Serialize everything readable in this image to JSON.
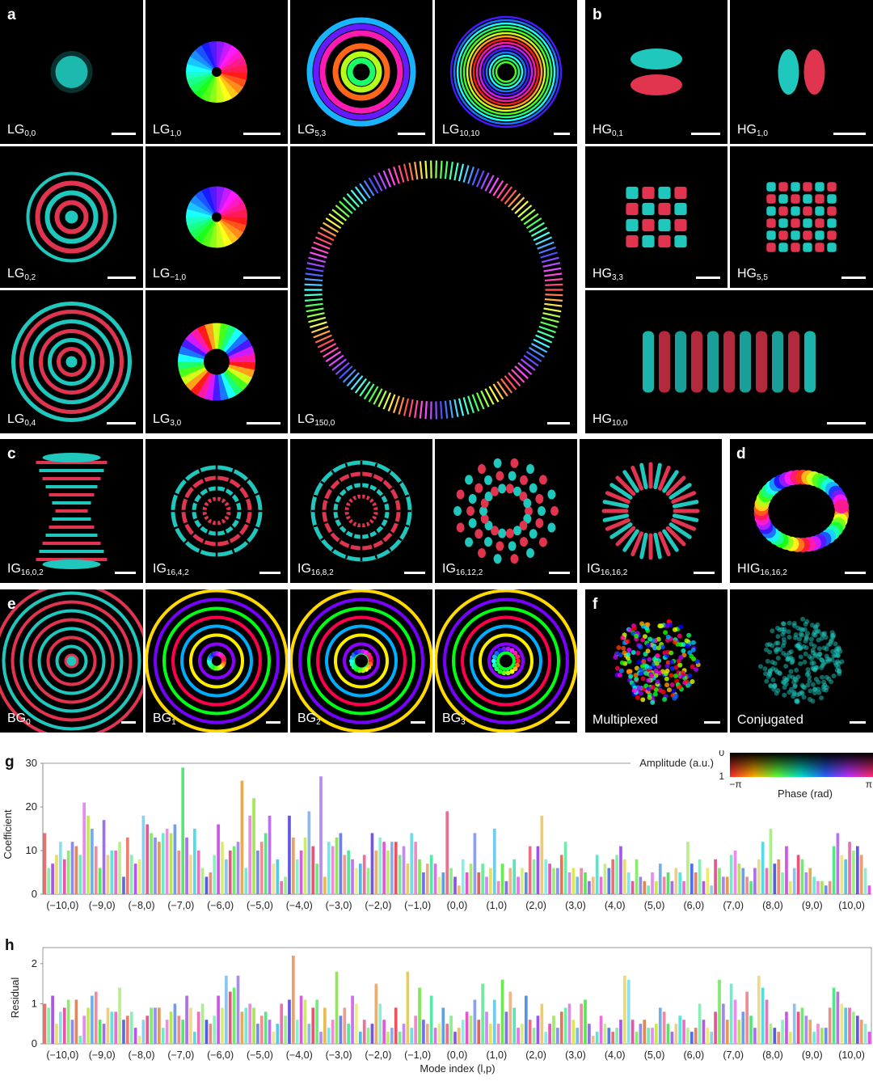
{
  "panel_letters": {
    "a": "a",
    "b": "b",
    "c": "c",
    "d": "d",
    "e": "e",
    "f": "f",
    "g": "g",
    "h": "h"
  },
  "tiles": [
    {
      "id": "lg00",
      "base": "LG",
      "sub": "0,0",
      "pattern": "gauss-cyan"
    },
    {
      "id": "lg10",
      "base": "LG",
      "sub": "1,0",
      "pattern": "vortex"
    },
    {
      "id": "lg53",
      "base": "LG",
      "sub": "5,3",
      "pattern": "rings-color"
    },
    {
      "id": "lg1010",
      "base": "LG",
      "sub": "10,10",
      "pattern": "rings-dense"
    },
    {
      "id": "hg01",
      "base": "HG",
      "sub": "0,1",
      "pattern": "hg-vertical"
    },
    {
      "id": "hg10",
      "base": "HG",
      "sub": "1,0",
      "pattern": "hg-horizontal"
    },
    {
      "id": "lg02",
      "base": "LG",
      "sub": "0,2",
      "pattern": "rings-rc-small"
    },
    {
      "id": "lgm10",
      "base": "LG",
      "sub": "−1,0",
      "pattern": "vortex"
    },
    {
      "id": "lg1500",
      "base": "LG",
      "sub": "150,0",
      "pattern": "big-ring"
    },
    {
      "id": "hg33",
      "base": "HG",
      "sub": "3,3",
      "pattern": "grid-4"
    },
    {
      "id": "hg55",
      "base": "HG",
      "sub": "5,5",
      "pattern": "grid-6"
    },
    {
      "id": "lg04",
      "base": "LG",
      "sub": "0,4",
      "pattern": "rings-rc-large"
    },
    {
      "id": "lg30",
      "base": "LG",
      "sub": "3,0",
      "pattern": "vortex-donut"
    },
    {
      "id": "hg100",
      "base": "HG",
      "sub": "10,0",
      "pattern": "hg-stripes"
    },
    {
      "id": "ig1602",
      "base": "IG",
      "sub": "16,0,2",
      "pattern": "ig-hourglass"
    },
    {
      "id": "ig1642",
      "base": "IG",
      "sub": "16,4,2",
      "pattern": "ig-web"
    },
    {
      "id": "ig1682",
      "base": "IG",
      "sub": "16,8,2",
      "pattern": "ig-web2"
    },
    {
      "id": "ig16122",
      "base": "IG",
      "sub": "16,12,2",
      "pattern": "ig-petal"
    },
    {
      "id": "ig16162",
      "base": "IG",
      "sub": "16,16,2",
      "pattern": "ig-spoke"
    },
    {
      "id": "hig16162",
      "base": "HIG",
      "sub": "16,16,2",
      "pattern": "rainbow-ring"
    },
    {
      "id": "bg0",
      "base": "BG",
      "sub": "0",
      "pattern": "bessel-0"
    },
    {
      "id": "bg1",
      "base": "BG",
      "sub": "1",
      "pattern": "bessel-1"
    },
    {
      "id": "bg2",
      "base": "BG",
      "sub": "2",
      "pattern": "bessel-2"
    },
    {
      "id": "bg3",
      "base": "BG",
      "sub": "3",
      "pattern": "bessel-3"
    },
    {
      "id": "mux",
      "base": "Multiplexed",
      "sub": "",
      "pattern": "speckle-color"
    },
    {
      "id": "conj",
      "base": "Conjugated",
      "sub": "",
      "pattern": "speckle-cyan"
    }
  ],
  "colorbar": {
    "amp_top": "0",
    "amp_bottom": "1",
    "amp_label": "Amplitude (a.u.)",
    "phase_left": "−π",
    "phase_right": "π",
    "phase_label": "Phase (rad)"
  },
  "chart_data": [
    {
      "type": "bar",
      "panel": "g",
      "ylabel": "Coefficient",
      "ylim": [
        0,
        30
      ],
      "yticks": [
        0,
        10,
        20,
        30
      ],
      "categories": [
        "(−10,0)",
        "(−9,0)",
        "(−8,0)",
        "(−7,0)",
        "(−6,0)",
        "(−5,0)",
        "(−4,0)",
        "(−3,0)",
        "(−2,0)",
        "(−1,0)",
        "(0,0)",
        "(1,0)",
        "(2,0)",
        "(3,0)",
        "(4,0)",
        "(5,0)",
        "(6,0)",
        "(7,0)",
        "(8,0)",
        "(9,0)",
        "(10,0)"
      ],
      "bars_per_group": 10,
      "groups": [
        [
          14,
          6,
          7,
          9,
          12,
          8,
          10,
          12,
          11,
          9
        ],
        [
          21,
          18,
          15,
          11,
          6,
          17,
          9,
          10,
          10,
          12
        ],
        [
          4,
          13,
          9,
          7,
          8,
          18,
          16,
          14,
          13,
          12
        ],
        [
          14,
          15,
          14,
          16,
          10,
          29,
          13,
          9,
          15,
          10
        ],
        [
          6,
          4,
          5,
          9,
          16,
          12,
          8,
          10,
          11,
          12
        ],
        [
          26,
          6,
          18,
          22,
          10,
          12,
          14,
          18,
          7,
          8
        ],
        [
          3,
          4,
          18,
          13,
          8,
          10,
          13,
          19,
          11,
          7
        ],
        [
          27,
          4,
          12,
          11,
          13,
          14,
          9,
          10,
          8,
          6
        ],
        [
          7,
          9,
          6,
          14,
          10,
          13,
          12,
          10,
          12,
          12
        ],
        [
          9,
          11,
          7,
          14,
          12,
          8,
          5,
          7,
          9,
          7
        ],
        [
          4,
          5,
          19,
          6,
          4,
          2,
          8,
          5,
          7,
          14
        ],
        [
          5,
          7,
          4,
          6,
          15,
          3,
          7,
          3,
          6,
          8
        ],
        [
          4,
          6,
          5,
          11,
          8,
          11,
          18,
          8,
          7,
          6
        ],
        [
          6,
          9,
          12,
          5,
          6,
          4,
          6,
          5,
          3,
          4
        ],
        [
          9,
          4,
          7,
          6,
          8,
          9,
          11,
          8,
          5,
          3
        ],
        [
          8,
          4,
          3,
          2,
          5,
          3,
          7,
          4,
          5,
          3
        ],
        [
          6,
          5,
          3,
          12,
          7,
          5,
          8,
          3,
          6,
          2
        ],
        [
          8,
          6,
          4,
          4,
          9,
          10,
          7,
          6,
          4,
          3
        ],
        [
          6,
          8,
          12,
          6,
          15,
          7,
          8,
          5,
          11,
          3
        ],
        [
          6,
          9,
          8,
          5,
          6,
          4,
          3,
          3,
          2,
          3
        ],
        [
          11,
          14,
          9,
          8,
          12,
          10,
          11,
          9,
          6,
          2
        ]
      ]
    },
    {
      "type": "bar",
      "panel": "h",
      "ylabel": "Residual",
      "xlabel": "Mode index (l,p)",
      "ylim": [
        0,
        2.4
      ],
      "yticks": [
        0,
        1,
        2
      ],
      "categories": [
        "(−10,0)",
        "(−9,0)",
        "(−8,0)",
        "(−7,0)",
        "(−6,0)",
        "(−5,0)",
        "(−4,0)",
        "(−3,0)",
        "(−2,0)",
        "(−1,0)",
        "(0,0)",
        "(1,0)",
        "(2,0)",
        "(3,0)",
        "(4,0)",
        "(5,0)",
        "(6,0)",
        "(7,0)",
        "(8,0)",
        "(9,0)",
        "(10,0)"
      ],
      "bars_per_group": 10,
      "groups": [
        [
          1.0,
          0.9,
          1.2,
          0.5,
          0.8,
          0.9,
          1.1,
          0.6,
          1.1,
          0.2
        ],
        [
          0.7,
          0.9,
          1.2,
          1.3,
          0.6,
          0.5,
          0.9,
          0.8,
          0.8,
          1.4
        ],
        [
          0.6,
          0.7,
          0.8,
          0.4,
          0.2,
          0.6,
          0.7,
          0.9,
          0.9,
          0.9
        ],
        [
          0.4,
          0.6,
          0.8,
          1.0,
          0.7,
          0.6,
          1.2,
          0.9,
          0.3,
          0.8
        ],
        [
          1.0,
          0.6,
          0.5,
          0.7,
          1.2,
          0.9,
          1.7,
          1.3,
          1.4,
          1.7
        ],
        [
          0.8,
          0.9,
          1.0,
          0.9,
          0.5,
          0.7,
          0.8,
          0.6,
          0.3,
          0.5
        ],
        [
          1.0,
          0.7,
          1.1,
          2.2,
          0.6,
          1.2,
          1.1,
          0.5,
          0.9,
          1.1
        ],
        [
          0.3,
          0.9,
          0.4,
          0.6,
          1.8,
          0.7,
          0.9,
          0.5,
          1.2,
          1.0
        ],
        [
          0.3,
          0.6,
          0.4,
          0.5,
          1.5,
          1.0,
          0.6,
          0.3,
          0.4,
          0.9
        ],
        [
          0.3,
          0.5,
          1.8,
          0.4,
          0.7,
          1.4,
          0.6,
          0.5,
          1.2,
          0.4
        ],
        [
          0.5,
          0.9,
          0.5,
          0.7,
          0.3,
          0.4,
          0.6,
          0.8,
          0.7,
          1.1
        ],
        [
          0.6,
          1.5,
          0.8,
          0.5,
          1.1,
          0.5,
          1.6,
          0.8,
          1.3,
          0.9
        ],
        [
          0.4,
          0.5,
          1.2,
          0.6,
          0.4,
          0.7,
          1.0,
          0.3,
          0.5,
          0.7
        ],
        [
          0.4,
          0.8,
          0.9,
          1.0,
          0.6,
          0.4,
          1.0,
          1.1,
          0.5,
          0.2
        ],
        [
          0.3,
          0.7,
          0.5,
          0.4,
          0.3,
          0.4,
          0.6,
          1.7,
          1.6,
          0.6
        ],
        [
          0.3,
          0.5,
          0.6,
          0.4,
          0.4,
          0.5,
          0.9,
          0.8,
          0.5,
          0.3
        ],
        [
          0.5,
          0.7,
          0.6,
          0.4,
          0.3,
          0.4,
          1.0,
          0.6,
          0.4,
          0.3
        ],
        [
          0.8,
          1.6,
          1.0,
          0.6,
          1.5,
          1.1,
          0.6,
          0.8,
          1.3,
          0.7
        ],
        [
          0.4,
          1.7,
          1.4,
          1.1,
          0.5,
          0.4,
          0.3,
          0.6,
          0.8,
          0.3
        ],
        [
          1.0,
          0.8,
          0.9,
          0.7,
          0.6,
          0.3,
          0.5,
          0.4,
          0.4,
          0.9
        ],
        [
          1.4,
          1.3,
          1.0,
          0.9,
          0.9,
          0.8,
          0.7,
          0.6,
          0.5,
          0.3
        ]
      ]
    }
  ]
}
